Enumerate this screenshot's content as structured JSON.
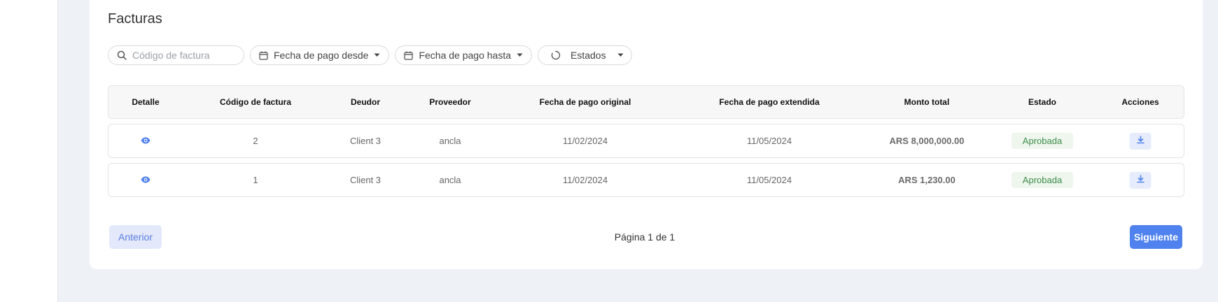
{
  "page": {
    "title": "Facturas"
  },
  "filters": {
    "search_placeholder": "Código de factura",
    "date_from_label": "Fecha de pago desde",
    "date_to_label": "Fecha de pago hasta",
    "status_label": "Estados"
  },
  "table": {
    "headers": {
      "detail": "Detalle",
      "code": "Código de factura",
      "debtor": "Deudor",
      "supplier": "Proveedor",
      "original_date": "Fecha de pago original",
      "extended_date": "Fecha de pago extendida",
      "total": "Monto total",
      "status": "Estado",
      "actions": "Acciones"
    },
    "rows": [
      {
        "code": "2",
        "debtor": "Client 3",
        "supplier": "ancla",
        "original_date": "11/02/2024",
        "extended_date": "11/05/2024",
        "total": "ARS 8,000,000.00",
        "status": "Aprobada"
      },
      {
        "code": "1",
        "debtor": "Client 3",
        "supplier": "ancla",
        "original_date": "11/02/2024",
        "extended_date": "11/05/2024",
        "total": "ARS 1,230.00",
        "status": "Aprobada"
      }
    ]
  },
  "pagination": {
    "prev_label": "Anterior",
    "page_info": "Página 1 de 1",
    "next_label": "Siguiente"
  },
  "colors": {
    "accent": "#4f82ef",
    "status_approved": "#3d8b4a",
    "eye_icon": "#4f82ef"
  },
  "icons": {
    "search": "search-icon",
    "calendar": "calendar-icon",
    "caret": "caret-down-icon",
    "status": "circle-loading-icon",
    "view": "eye-icon",
    "download": "download-icon"
  }
}
